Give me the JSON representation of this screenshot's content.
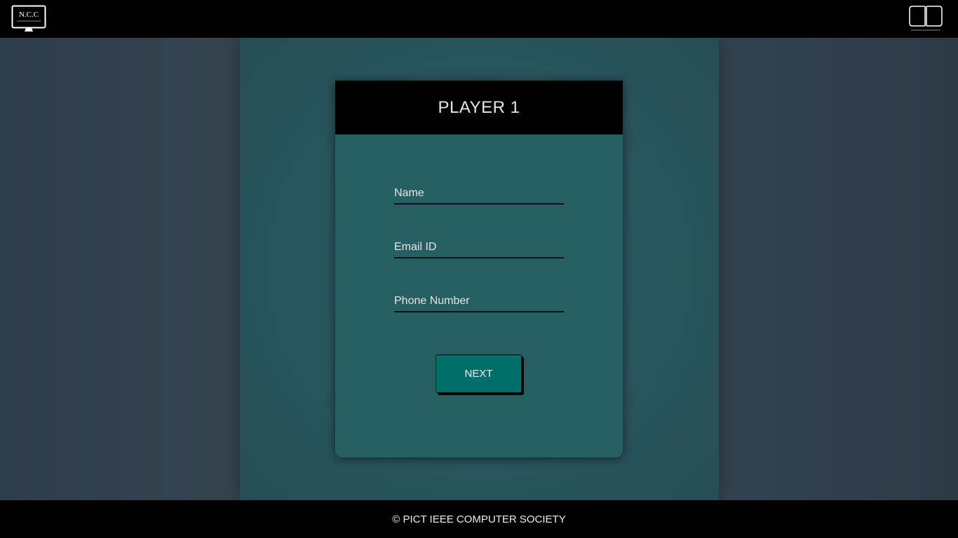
{
  "header": {
    "left_logo_text": "N.C.C",
    "right_logo_icon": "brand-logo-icon"
  },
  "card": {
    "title": "PLAYER 1",
    "fields": {
      "name_placeholder": "Name",
      "email_placeholder": "Email ID",
      "phone_placeholder": "Phone Number"
    },
    "next_label": "NEXT"
  },
  "footer": {
    "copyright": "© PICT IEEE COMPUTER SOCIETY"
  },
  "colors": {
    "topbar": "#000000",
    "card": "#255f63",
    "button": "#006f6a"
  }
}
